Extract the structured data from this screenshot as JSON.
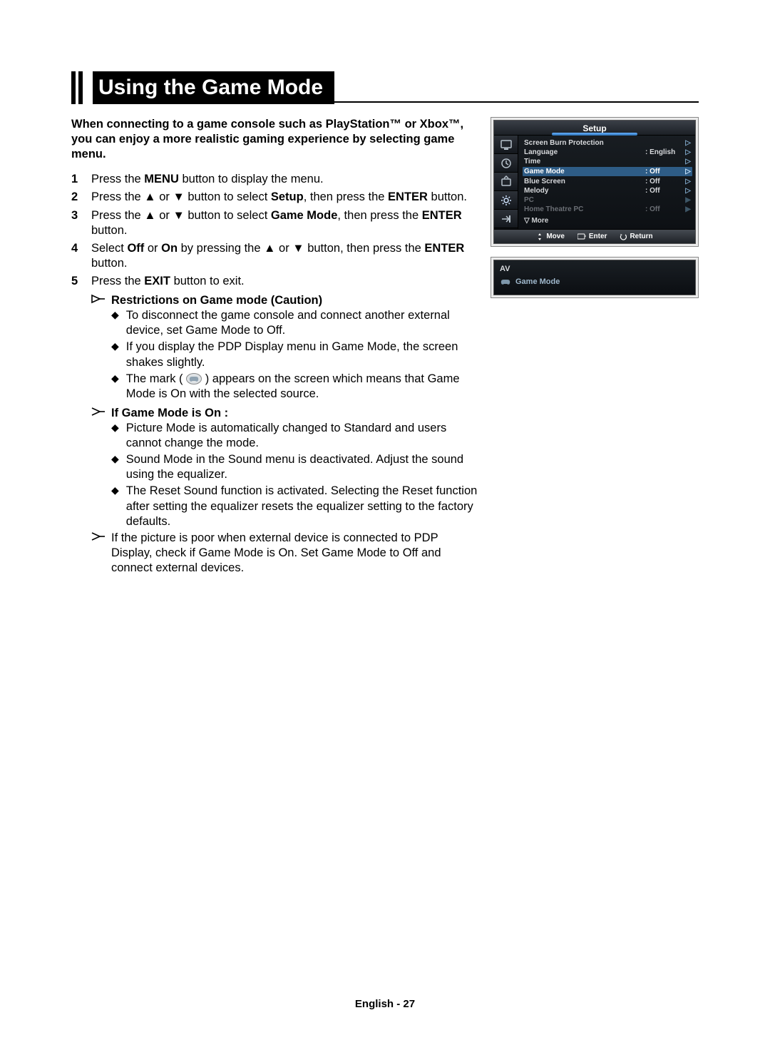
{
  "title": "Using the Game Mode",
  "intro": "When connecting to a game console such as PlayStation™ or Xbox™, you can enjoy a more realistic gaming experience by selecting game menu.",
  "steps": [
    {
      "n": "1",
      "parts": [
        "Press the ",
        "MENU",
        " button to display the menu."
      ]
    },
    {
      "n": "2",
      "parts": [
        "Press the ▲ or ▼ button to select ",
        "Setup",
        ", then press the ",
        "ENTER",
        " button."
      ]
    },
    {
      "n": "3",
      "parts": [
        "Press the ▲ or ▼ button to select ",
        "Game Mode",
        ", then press the ",
        "ENTER",
        " button."
      ]
    },
    {
      "n": "4",
      "parts": [
        "Select ",
        "Off",
        " or ",
        "On",
        " by pressing the ▲ or ▼ button, then press the ",
        "ENTER",
        " button."
      ]
    },
    {
      "n": "5",
      "parts": [
        "Press the ",
        "EXIT",
        " button to exit."
      ]
    }
  ],
  "restrictions_heading": "Restrictions on Game mode (Caution)",
  "restrictions": [
    "To disconnect the game console and connect another external device, set Game Mode to Off.",
    "If you display the PDP Display menu in Game Mode, the screen shakes slightly.",
    "The mark ( 🎮 ) appears on the screen which means that Game Mode is On with the selected source."
  ],
  "ifon_heading": "If Game Mode is On :",
  "ifon_items": [
    "Picture Mode is automatically changed to Standard and users cannot change the mode.",
    "Sound Mode in the Sound menu is deactivated. Adjust the sound using the equalizer.",
    "The Reset Sound function is activated. Selecting the Reset function after setting the equalizer resets the equalizer setting to the factory defaults."
  ],
  "poor_note": "If the picture is poor when external device is connected to PDP Display, check if Game Mode is On. Set Game Mode to Off and connect external devices.",
  "osd": {
    "title": "Setup",
    "rows": [
      {
        "label": "Screen Burn Protection",
        "val": "",
        "hl": false,
        "disabled": false
      },
      {
        "label": "Language",
        "val": ": English",
        "hl": false,
        "disabled": false
      },
      {
        "label": "Time",
        "val": "",
        "hl": false,
        "disabled": false
      },
      {
        "label": "Game Mode",
        "val": ": Off",
        "hl": true,
        "disabled": false
      },
      {
        "label": "Blue Screen",
        "val": ": Off",
        "hl": false,
        "disabled": false
      },
      {
        "label": "Melody",
        "val": ": Off",
        "hl": false,
        "disabled": false
      },
      {
        "label": "PC",
        "val": "",
        "hl": false,
        "disabled": true
      },
      {
        "label": "Home Theatre PC",
        "val": ": Off",
        "hl": false,
        "disabled": true
      }
    ],
    "more": "▽ More",
    "footer": {
      "move": "Move",
      "enter": "Enter",
      "return": "Return"
    }
  },
  "osd2": {
    "header": "AV",
    "label": "Game Mode"
  },
  "footer": "English - 27"
}
